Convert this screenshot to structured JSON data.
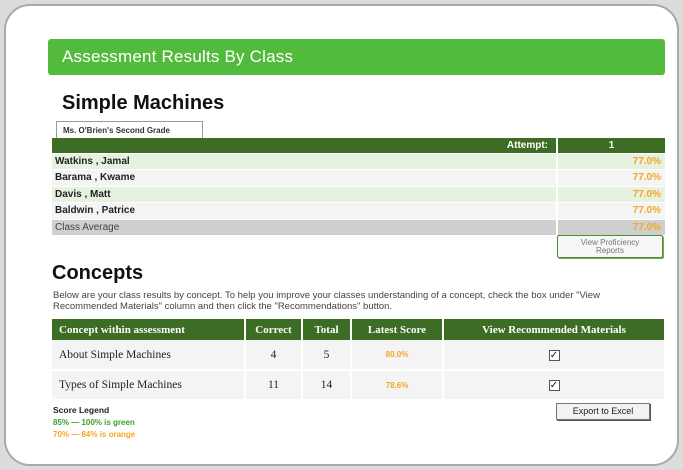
{
  "header": {
    "title": "Assessment Results By Class"
  },
  "subject": "Simple Machines",
  "class_tab": "Ms. O'Brien's Second Grade",
  "results": {
    "attempt_label": "Attempt:",
    "attempt_value": "1",
    "students": [
      {
        "name": "Watkins , Jamal",
        "score": "77.0%"
      },
      {
        "name": "Barama , Kwame",
        "score": "77.0%"
      },
      {
        "name": "Davis , Matt",
        "score": "77.0%"
      },
      {
        "name": "Baldwin , Patrice",
        "score": "77.0%"
      }
    ],
    "average_label": "Class Average",
    "average_score": "77.0%"
  },
  "buttons": {
    "proficiency_line1": "View Proficiency",
    "proficiency_line2": "Reports",
    "export": "Export to Excel"
  },
  "concepts": {
    "title": "Concepts",
    "description": "Below are your class results by concept. To help you improve your classes understanding of a concept, check the box under \"View Recommended Materials\" column and then click the \"Recommendations\" button.",
    "headers": [
      "Concept within assessment",
      "Correct",
      "Total",
      "Latest Score",
      "View Recommended Materials"
    ],
    "rows": [
      {
        "concept": "About Simple Machines",
        "correct": "4",
        "total": "5",
        "latest": "80.0%",
        "checked": "✓"
      },
      {
        "concept": "Types of Simple Machines",
        "correct": "11",
        "total": "14",
        "latest": "78.6%",
        "checked": "✓"
      }
    ]
  },
  "legend": {
    "title": "Score Legend",
    "green": "85% — 100% is green",
    "orange": "70% — 84% is orange"
  },
  "colors": {
    "accent_green": "#52ba3c",
    "table_green": "#3d6c24",
    "score_orange": "#f5a623"
  }
}
